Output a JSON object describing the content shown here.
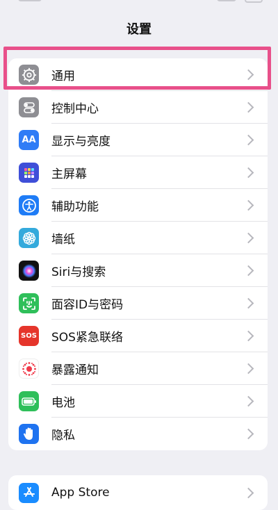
{
  "header": {
    "title": "设置"
  },
  "settings_group_1": [
    {
      "label": "通用",
      "icon": "gear-icon"
    },
    {
      "label": "控制中心",
      "icon": "control-center-icon"
    },
    {
      "label": "显示与亮度",
      "icon": "display-brightness-icon",
      "glyph": "AA"
    },
    {
      "label": "主屏幕",
      "icon": "home-screen-icon"
    },
    {
      "label": "辅助功能",
      "icon": "accessibility-icon"
    },
    {
      "label": "墙纸",
      "icon": "wallpaper-icon"
    },
    {
      "label": "Siri与搜索",
      "icon": "siri-icon"
    },
    {
      "label": "面容ID与密码",
      "icon": "face-id-icon"
    },
    {
      "label": "SOS紧急联络",
      "icon": "sos-icon",
      "glyph": "SOS"
    },
    {
      "label": "暴露通知",
      "icon": "exposure-notification-icon"
    },
    {
      "label": "电池",
      "icon": "battery-icon"
    },
    {
      "label": "隐私",
      "icon": "privacy-hand-icon"
    }
  ],
  "settings_group_2": [
    {
      "label": "App Store",
      "icon": "app-store-icon"
    }
  ],
  "colors": {
    "highlight": "#e8508a",
    "background": "#efeff4"
  }
}
